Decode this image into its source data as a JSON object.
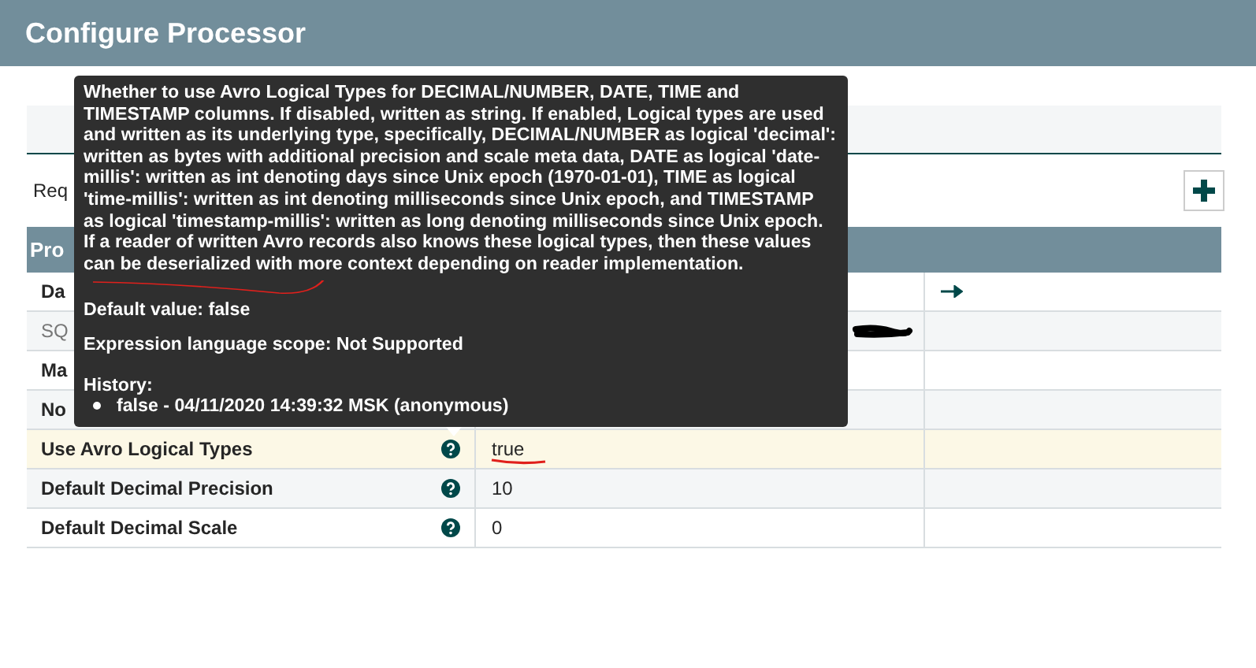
{
  "window": {
    "title": "Configure Processor"
  },
  "section_label": "Req",
  "table": {
    "header": "Pro",
    "rows": [
      {
        "name": "Da",
        "required": true,
        "help": false,
        "redacted": false,
        "link": true,
        "highlighted": false
      },
      {
        "name": "SQ",
        "required": false,
        "help": false,
        "redacted": true,
        "link": false,
        "highlighted": false
      },
      {
        "name": "Ma",
        "required": true,
        "help": false,
        "redacted": false,
        "link": false,
        "highlighted": false
      },
      {
        "name": "No",
        "required": true,
        "help": false,
        "redacted": false,
        "link": false,
        "highlighted": false
      },
      {
        "name": "Use Avro Logical Types",
        "required": true,
        "help": true,
        "value": "true",
        "redacted": false,
        "link": false,
        "highlighted": true
      },
      {
        "name": "Default Decimal Precision",
        "required": true,
        "help": true,
        "value": "10",
        "redacted": false,
        "link": false,
        "highlighted": false
      },
      {
        "name": "Default Decimal Scale",
        "required": true,
        "help": true,
        "value": "0",
        "redacted": false,
        "link": false,
        "highlighted": false
      }
    ]
  },
  "tooltip": {
    "description": "Whether to use Avro Logical Types for DECIMAL/NUMBER, DATE, TIME and TIMESTAMP columns. If disabled, written as string. If enabled, Logical types are used and written as its underlying type, specifically, DECIMAL/NUMBER as logical 'decimal': written as bytes with additional precision and scale meta data, DATE as logical 'date-millis': written as int denoting days since Unix epoch (1970-01-01), TIME as logical 'time-millis': written as int denoting milliseconds since Unix epoch, and TIMESTAMP as logical 'timestamp-millis': written as long denoting milliseconds since Unix epoch. If a reader of written Avro records also knows these logical types, then these values can be deserialized with more context depending on reader implementation.",
    "default_value": "Default value: false",
    "el_scope": "Expression language scope: Not Supported",
    "history_label": "History:",
    "history": [
      "false - 04/11/2020 14:39:32 MSK (anonymous)"
    ]
  }
}
